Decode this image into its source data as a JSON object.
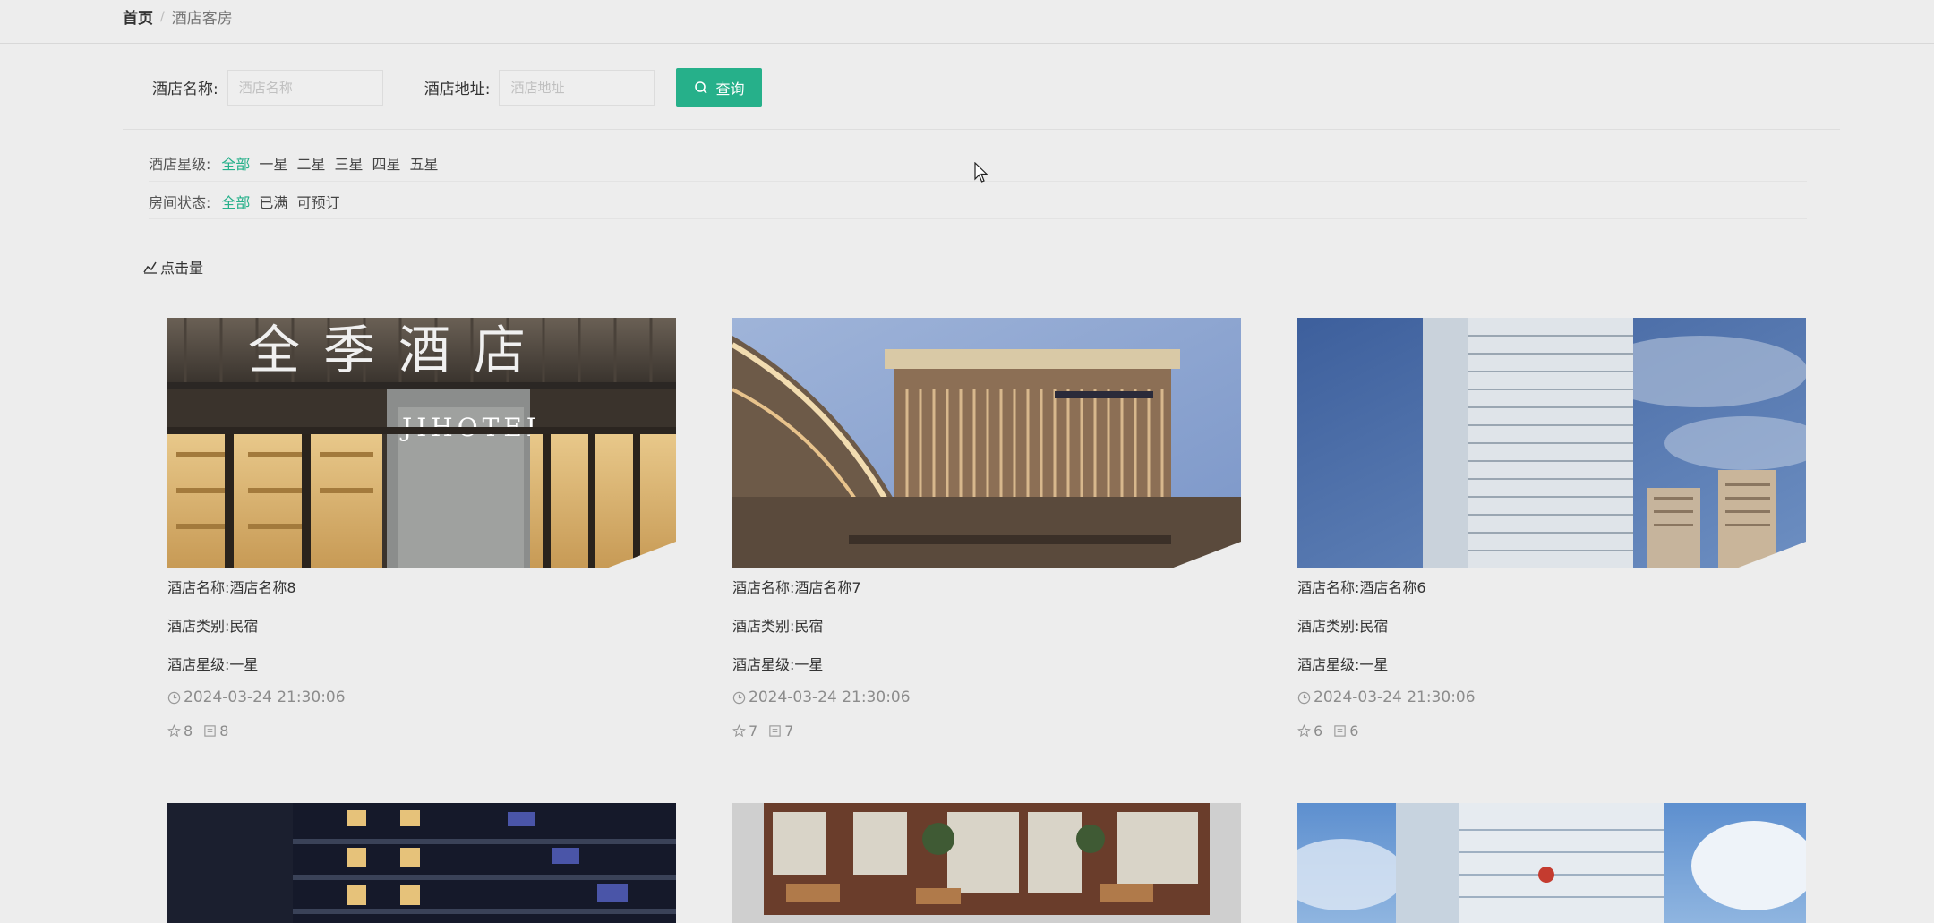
{
  "breadcrumb": {
    "home": "首页",
    "separator": "/",
    "current": "酒店客房"
  },
  "search": {
    "name_label": "酒店名称:",
    "name_placeholder": "酒店名称",
    "address_label": "酒店地址:",
    "address_placeholder": "酒店地址",
    "button_label": "查询"
  },
  "filters": {
    "star_label": "酒店星级:",
    "star_options": [
      "全部",
      "一星",
      "二星",
      "三星",
      "四星",
      "五星"
    ],
    "star_active": "全部",
    "status_label": "房间状态:",
    "status_options": [
      "全部",
      "已满",
      "可预订"
    ],
    "status_active": "全部"
  },
  "sort": {
    "label": "点击量"
  },
  "accent_color": "#26b08a",
  "cards": [
    {
      "name": "酒店名称:酒店名称8",
      "type": "酒店类别:民宿",
      "star": "酒店星级:一星",
      "date": "2024-03-24 21:30:06",
      "likes": "8",
      "comments": "8",
      "image": "hotel-storefront-jihotel",
      "sign_cn": "全季酒店",
      "sign_en": "JIHOTEL"
    },
    {
      "name": "酒店名称:酒店名称7",
      "type": "酒店类别:民宿",
      "star": "酒店星级:一星",
      "date": "2024-03-24 21:30:06",
      "likes": "7",
      "comments": "7",
      "image": "hotel-building-facade"
    },
    {
      "name": "酒店名称:酒店名称6",
      "type": "酒店类别:民宿",
      "star": "酒店星级:一星",
      "date": "2024-03-24 21:30:06",
      "likes": "6",
      "comments": "6",
      "image": "hotel-tower-skyline"
    },
    {
      "image": "hotel-night-building"
    },
    {
      "image": "hotel-street-shops"
    },
    {
      "image": "hotel-tower-blue-sky"
    }
  ]
}
